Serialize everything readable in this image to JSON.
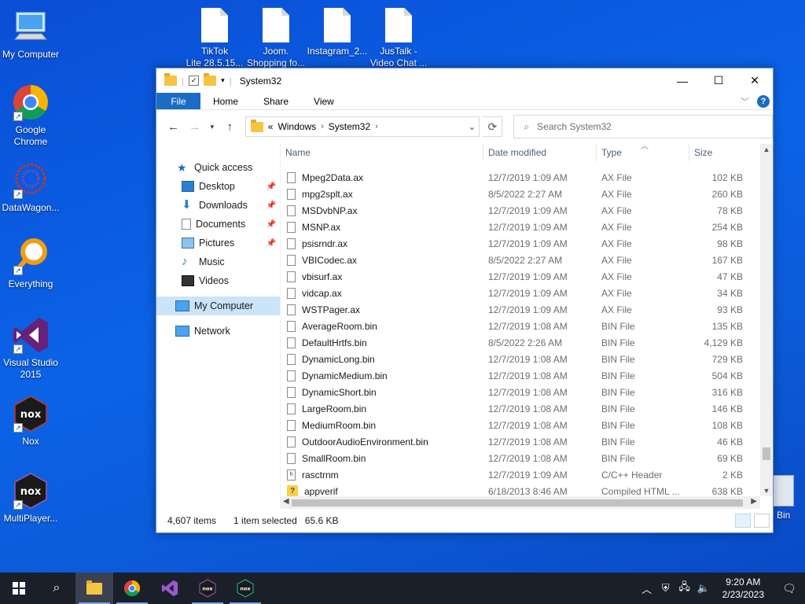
{
  "desktop": {
    "icons": [
      {
        "label": "My Computer"
      },
      {
        "label": "Google Chrome"
      },
      {
        "label": "DataWagon..."
      },
      {
        "label": "Everything"
      },
      {
        "label": "Visual Studio 2015"
      },
      {
        "label": "Nox"
      },
      {
        "label": "MultiPlayer..."
      }
    ],
    "top_files": [
      {
        "label_1": "TikTok",
        "label_2": "Lite 28.5.15..."
      },
      {
        "label_1": "Joom.",
        "label_2": "Shopping fo..."
      },
      {
        "label_1": "Instagram_2...",
        "label_2": ""
      },
      {
        "label_1": "JusTalk -",
        "label_2": "Video Chat ..."
      }
    ],
    "recycle_bin_label": "Bin"
  },
  "window": {
    "title": "System32",
    "ribbon_tabs": [
      "File",
      "Home",
      "Share",
      "View"
    ],
    "address": {
      "segments": [
        "Windows",
        "System32"
      ],
      "prefix": "«"
    },
    "search_placeholder": "Search System32",
    "navpane": {
      "quick_access": "Quick access",
      "items": [
        {
          "label": "Desktop",
          "pinned": true
        },
        {
          "label": "Downloads",
          "pinned": true
        },
        {
          "label": "Documents",
          "pinned": true
        },
        {
          "label": "Pictures",
          "pinned": true
        },
        {
          "label": "Music",
          "pinned": false
        },
        {
          "label": "Videos",
          "pinned": false
        }
      ],
      "my_computer": "My Computer",
      "network": "Network"
    },
    "columns": {
      "name": "Name",
      "date": "Date modified",
      "type": "Type",
      "size": "Size"
    },
    "files": [
      {
        "name": "Mpeg2Data.ax",
        "date": "12/7/2019 1:09 AM",
        "type": "AX File",
        "size": "102 KB",
        "icon": "file"
      },
      {
        "name": "mpg2splt.ax",
        "date": "8/5/2022 2:27 AM",
        "type": "AX File",
        "size": "260 KB",
        "icon": "file"
      },
      {
        "name": "MSDvbNP.ax",
        "date": "12/7/2019 1:09 AM",
        "type": "AX File",
        "size": "78 KB",
        "icon": "file"
      },
      {
        "name": "MSNP.ax",
        "date": "12/7/2019 1:09 AM",
        "type": "AX File",
        "size": "254 KB",
        "icon": "file"
      },
      {
        "name": "psisrndr.ax",
        "date": "12/7/2019 1:09 AM",
        "type": "AX File",
        "size": "98 KB",
        "icon": "file"
      },
      {
        "name": "VBICodec.ax",
        "date": "8/5/2022 2:27 AM",
        "type": "AX File",
        "size": "167 KB",
        "icon": "file"
      },
      {
        "name": "vbisurf.ax",
        "date": "12/7/2019 1:09 AM",
        "type": "AX File",
        "size": "47 KB",
        "icon": "file"
      },
      {
        "name": "vidcap.ax",
        "date": "12/7/2019 1:09 AM",
        "type": "AX File",
        "size": "34 KB",
        "icon": "file"
      },
      {
        "name": "WSTPager.ax",
        "date": "12/7/2019 1:09 AM",
        "type": "AX File",
        "size": "93 KB",
        "icon": "file"
      },
      {
        "name": "AverageRoom.bin",
        "date": "12/7/2019 1:08 AM",
        "type": "BIN File",
        "size": "135 KB",
        "icon": "file"
      },
      {
        "name": "DefaultHrtfs.bin",
        "date": "8/5/2022 2:26 AM",
        "type": "BIN File",
        "size": "4,129 KB",
        "icon": "file"
      },
      {
        "name": "DynamicLong.bin",
        "date": "12/7/2019 1:08 AM",
        "type": "BIN File",
        "size": "729 KB",
        "icon": "file"
      },
      {
        "name": "DynamicMedium.bin",
        "date": "12/7/2019 1:08 AM",
        "type": "BIN File",
        "size": "504 KB",
        "icon": "file"
      },
      {
        "name": "DynamicShort.bin",
        "date": "12/7/2019 1:08 AM",
        "type": "BIN File",
        "size": "316 KB",
        "icon": "file"
      },
      {
        "name": "LargeRoom.bin",
        "date": "12/7/2019 1:08 AM",
        "type": "BIN File",
        "size": "146 KB",
        "icon": "file"
      },
      {
        "name": "MediumRoom.bin",
        "date": "12/7/2019 1:08 AM",
        "type": "BIN File",
        "size": "108 KB",
        "icon": "file"
      },
      {
        "name": "OutdoorAudioEnvironment.bin",
        "date": "12/7/2019 1:08 AM",
        "type": "BIN File",
        "size": "46 KB",
        "icon": "file"
      },
      {
        "name": "SmallRoom.bin",
        "date": "12/7/2019 1:08 AM",
        "type": "BIN File",
        "size": "69 KB",
        "icon": "file"
      },
      {
        "name": "rasctrnm",
        "date": "12/7/2019 1:09 AM",
        "type": "C/C++ Header",
        "size": "2 KB",
        "icon": "header"
      },
      {
        "name": "appverif",
        "date": "6/18/2013 8:46 AM",
        "type": "Compiled HTML ...",
        "size": "638 KB",
        "icon": "chm"
      }
    ],
    "status": {
      "items": "4,607 items",
      "selected": "1 item selected",
      "size": "65.6 KB"
    }
  },
  "taskbar": {
    "time": "9:20 AM",
    "date": "2/23/2023"
  }
}
